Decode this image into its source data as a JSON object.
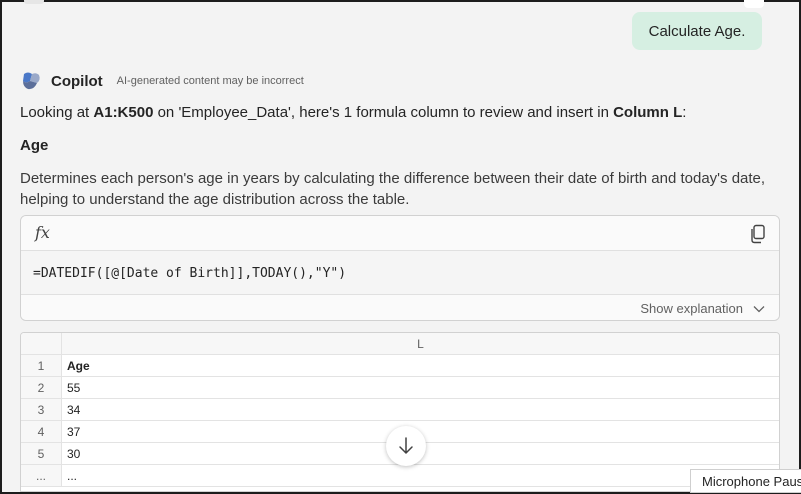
{
  "user_message": "Calculate Age.",
  "copilot": {
    "name": "Copilot",
    "disclaimer": "AI-generated content may be incorrect"
  },
  "intro": {
    "prefix": "Looking at ",
    "range": "A1:K500",
    "middle": " on 'Employee_Data', here's 1 formula column to review and insert in ",
    "column": "Column L",
    "suffix": ":"
  },
  "section_title": "Age",
  "description": "Determines each person's age in years by calculating the difference between their date of birth and today's date, helping to understand the age distribution across the table.",
  "formula_card": {
    "icon": "fx-icon",
    "formula": "=DATEDIF([@[Date of Birth]],TODAY(),\"Y\")",
    "show_explanation": "Show explanation"
  },
  "grid": {
    "column_letter": "L",
    "rows": [
      {
        "num": "1",
        "value": "Age"
      },
      {
        "num": "2",
        "value": "55"
      },
      {
        "num": "3",
        "value": "34"
      },
      {
        "num": "4",
        "value": "37"
      },
      {
        "num": "5",
        "value": "30"
      },
      {
        "num": "...",
        "value": "..."
      }
    ]
  },
  "tooltip": "Microphone Paused",
  "colors": {
    "user_bubble": "#d6efe2",
    "background": "#f3f3f3",
    "border": "#d1d1d1"
  }
}
